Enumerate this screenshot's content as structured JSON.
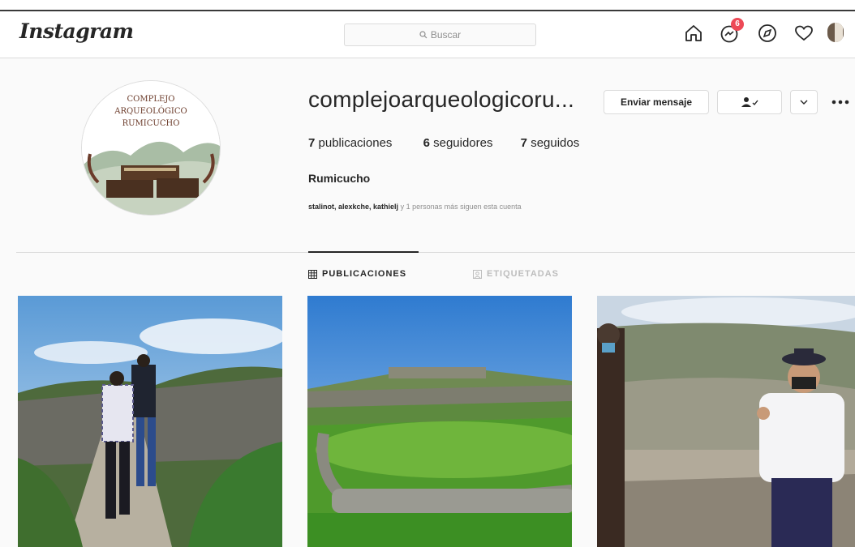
{
  "nav": {
    "logo": "Instagram",
    "search_placeholder": "Buscar",
    "notification_count": "6"
  },
  "profile": {
    "username": "complejoarqueologicoru...",
    "avatar_text": [
      "COMPLEJO",
      "ARQUEOLÓGICO",
      "RUMICUCHO"
    ],
    "message_button": "Enviar mensaje",
    "stats": {
      "posts_count": "7",
      "posts_label": "publicaciones",
      "followers_count": "6",
      "followers_label": "seguidores",
      "following_count": "7",
      "following_label": "seguidos"
    },
    "full_name": "Rumicucho",
    "followed_by_names": "stalinot, alexkche, kathielj",
    "followed_by_suffix": "y 1 personas más siguen esta cuenta"
  },
  "tabs": {
    "posts": "PUBLICACIONES",
    "tagged": "ETIQUETADAS"
  },
  "colors": {
    "badge": "#ed4956",
    "border": "#dbdbdb",
    "text": "#262626",
    "muted": "#8e8e8e"
  }
}
